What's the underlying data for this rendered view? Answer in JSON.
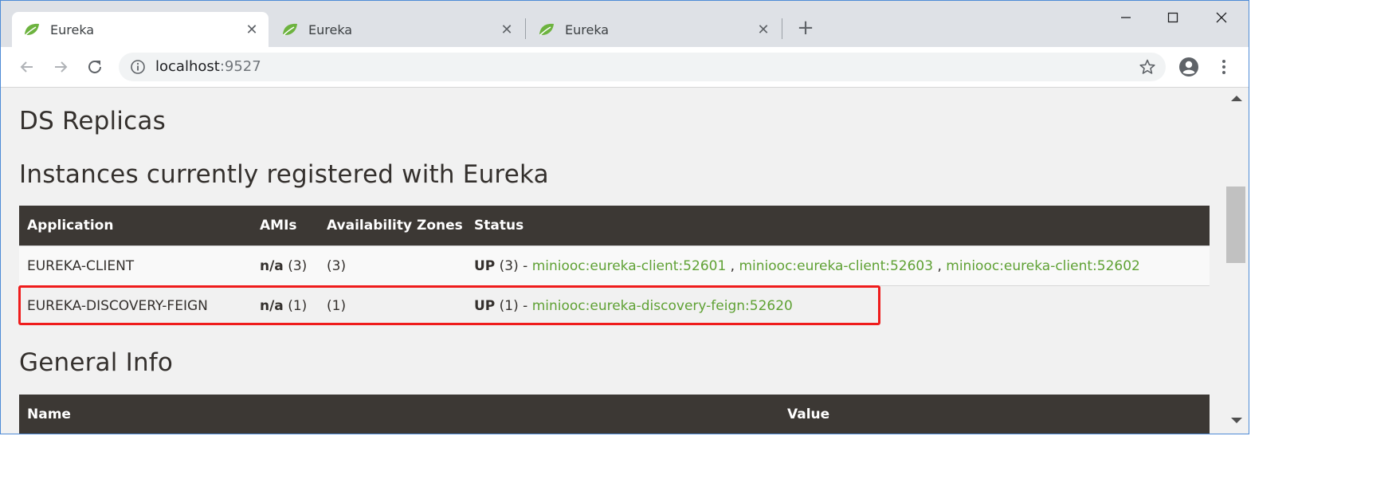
{
  "browser": {
    "tabs": [
      {
        "title": "Eureka",
        "active": true
      },
      {
        "title": "Eureka",
        "active": false
      },
      {
        "title": "Eureka",
        "active": false
      }
    ],
    "new_tab_label": "+",
    "address": {
      "host": "localhost",
      "port": ":9527"
    }
  },
  "page": {
    "ds_replicas_title": "DS Replicas",
    "instances_title": "Instances currently registered with Eureka",
    "instances_table": {
      "headers": [
        "Application",
        "AMIs",
        "Availability Zones",
        "Status"
      ],
      "rows": [
        {
          "application": "EUREKA-CLIENT",
          "amis_label": "n/a",
          "amis_count": "(3)",
          "zones": "(3)",
          "status_label": "UP",
          "status_count": "(3) -",
          "links": [
            "miniooc:eureka-client:52601",
            "miniooc:eureka-client:52603",
            "miniooc:eureka-client:52602"
          ]
        },
        {
          "application": "EUREKA-DISCOVERY-FEIGN",
          "amis_label": "n/a",
          "amis_count": "(1)",
          "zones": "(1)",
          "status_label": "UP",
          "status_count": "(1) -",
          "links": [
            "miniooc:eureka-discovery-feign:52620"
          ]
        }
      ]
    },
    "general_info_title": "General Info",
    "general_table": {
      "headers": [
        "Name",
        "Value"
      ]
    }
  },
  "colors": {
    "table_header_bg": "#3c3834",
    "link_green": "#5fa134",
    "highlight_red": "#ef1c1c",
    "spring_leaf": "#6db33f"
  }
}
